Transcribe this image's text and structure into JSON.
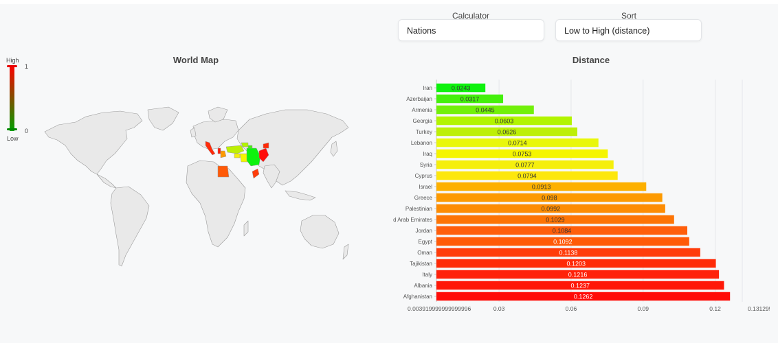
{
  "controls": {
    "calculator": {
      "label": "Calculator",
      "value": "Nations"
    },
    "sort": {
      "label": "Sort",
      "value": "Low to High (distance)"
    }
  },
  "map_panel": {
    "title": "World Map",
    "legend": {
      "high_label": "High",
      "low_label": "Low",
      "max_value": "1",
      "min_value": "0"
    },
    "colors": {
      "land": "#e9e9e9",
      "border": "#9a9a9a",
      "low": "#00a000",
      "high": "#ff0000"
    }
  },
  "chart_panel": {
    "title": "Distance"
  },
  "chart_data": {
    "type": "bar",
    "orientation": "horizontal",
    "title": "Distance",
    "categories": [
      "Iran",
      "Azerbaijan",
      "Armenia",
      "Georgia",
      "Turkey",
      "Lebanon",
      "Iraq",
      "Syria",
      "Cyprus",
      "Israel",
      "Greece",
      "Palestinian",
      "d Arab Emirates",
      "Jordan",
      "Egypt",
      "Oman",
      "Tajikistan",
      "Italy",
      "Albania",
      "Afghanistan"
    ],
    "values": [
      0.0243,
      0.0317,
      0.0445,
      0.0603,
      0.0626,
      0.0714,
      0.0753,
      0.0777,
      0.0794,
      0.0913,
      0.098,
      0.0992,
      0.1029,
      0.1084,
      0.1092,
      0.1138,
      0.1203,
      0.1216,
      0.1237,
      0.1262
    ],
    "colors": [
      "#0ef20e",
      "#44f00c",
      "#72f00a",
      "#b2f400",
      "#bdef06",
      "#e9f70b",
      "#f5f500",
      "#f5ef0d",
      "#fde70c",
      "#fdb000",
      "#fd9a01",
      "#fd8c03",
      "#fd7405",
      "#ff5e0b",
      "#ff5a08",
      "#ff3c0a",
      "#ff2a07",
      "#ff220a",
      "#ff1808",
      "#ff0c08"
    ],
    "label_colors": [
      "#333333",
      "#333333",
      "#333333",
      "#333333",
      "#333333",
      "#333333",
      "#333333",
      "#333333",
      "#333333",
      "#333333",
      "#333333",
      "#333333",
      "#333333",
      "#333333",
      "#ffffff",
      "#ffffff",
      "#ffffff",
      "#ffffff",
      "#ffffff",
      "#ffffff"
    ],
    "x_ticks": [
      "0.003919999999999996",
      "0.03",
      "0.06",
      "0.09",
      "0.12",
      "0.131295"
    ],
    "xlim": [
      0.003919999999999996,
      0.131295
    ],
    "grid": true
  }
}
